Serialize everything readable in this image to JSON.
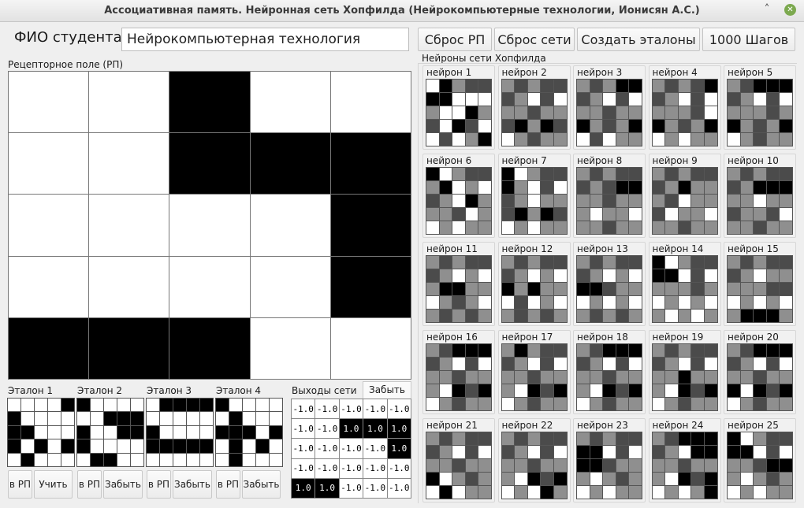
{
  "window": {
    "title": "Ассоциативная память. Нейронная сеть Хопфилда (Нейрокомпьютерные технологии, Ионисян А.С.)",
    "minimize_icon": "minimize-icon",
    "close_icon": "close-icon"
  },
  "student": {
    "label": "ФИО студента",
    "value": "Нейрокомпьютерная технология"
  },
  "toolbar": {
    "reset_field": "Сброс РП",
    "reset_net": "Сброс сети",
    "create_etalons": "Создать эталоны",
    "steps": "1000 Шагов"
  },
  "receptor_field": {
    "label": "Рецепторное поле (РП)",
    "cells": [
      [
        0,
        0,
        1,
        0,
        0
      ],
      [
        0,
        0,
        1,
        1,
        1
      ],
      [
        0,
        0,
        0,
        0,
        1
      ],
      [
        0,
        0,
        0,
        0,
        1
      ],
      [
        1,
        1,
        1,
        0,
        0
      ]
    ]
  },
  "etalons": [
    {
      "label": "Эталон 1",
      "button_to_field": "в РП",
      "button_action": "Учить",
      "cells": [
        [
          0,
          0,
          0,
          0,
          1
        ],
        [
          1,
          0,
          0,
          0,
          0
        ],
        [
          1,
          1,
          0,
          0,
          0
        ],
        [
          1,
          0,
          1,
          0,
          1
        ],
        [
          0,
          1,
          0,
          0,
          0
        ]
      ]
    },
    {
      "label": "Эталон 2",
      "button_to_field": "в РП",
      "button_action": "Забыть",
      "cells": [
        [
          1,
          0,
          0,
          0,
          0
        ],
        [
          0,
          0,
          1,
          1,
          1
        ],
        [
          1,
          0,
          0,
          1,
          1
        ],
        [
          1,
          0,
          0,
          0,
          0
        ],
        [
          0,
          1,
          1,
          0,
          0
        ]
      ]
    },
    {
      "label": "Эталон 3",
      "button_to_field": "в РП",
      "button_action": "Забыть",
      "cells": [
        [
          0,
          1,
          1,
          1,
          1
        ],
        [
          0,
          0,
          0,
          0,
          0
        ],
        [
          1,
          0,
          0,
          0,
          0
        ],
        [
          1,
          1,
          1,
          1,
          1
        ],
        [
          0,
          0,
          0,
          0,
          0
        ]
      ]
    },
    {
      "label": "Эталон 4",
      "button_to_field": "в РП",
      "button_action": "Забыть",
      "cells": [
        [
          1,
          0,
          0,
          0,
          0
        ],
        [
          0,
          1,
          0,
          0,
          0
        ],
        [
          1,
          1,
          1,
          0,
          1
        ],
        [
          0,
          1,
          0,
          1,
          0
        ],
        [
          0,
          1,
          0,
          0,
          0
        ]
      ]
    }
  ],
  "outputs": {
    "label": "Выходы сети",
    "forget_tab": "Забыть",
    "rows": [
      [
        "-1.0",
        "-1.0",
        "-1.0",
        "-1.0",
        "-1.0"
      ],
      [
        "-1.0",
        "-1.0",
        "1.0",
        "1.0",
        "1.0"
      ],
      [
        "-1.0",
        "-1.0",
        "-1.0",
        "-1.0",
        "1.0"
      ],
      [
        "-1.0",
        "-1.0",
        "-1.0",
        "-1.0",
        "-1.0"
      ],
      [
        "1.0",
        "1.0",
        "-1.0",
        "-1.0",
        "-1.0"
      ]
    ]
  },
  "neurons": {
    "label": "Нейроны сети Хопфилда",
    "items": [
      {
        "title": "нейрон 1",
        "cells": [
          "wbgdd",
          "bbwww",
          "gwwbg",
          "dwbdw",
          "wdwgb"
        ]
      },
      {
        "title": "нейрон 2",
        "cells": [
          "gdgdd",
          "dgwdw",
          "ggdgg",
          "dbgbd",
          "wgdgg"
        ]
      },
      {
        "title": "нейрон 3",
        "cells": [
          "gdgbb",
          "dgwdw",
          "ggdgg",
          "bgdgb",
          "wdwgg"
        ]
      },
      {
        "title": "нейрон 4",
        "cells": [
          "gdgdb",
          "dgwdw",
          "gggdw",
          "bgdgb",
          "wgwgg"
        ]
      },
      {
        "title": "нейрон 5",
        "cells": [
          "gdbbb",
          "dgwdw",
          "gggdg",
          "bgdgb",
          "wgdgg"
        ]
      },
      {
        "title": "нейрон 6",
        "cells": [
          "bwgdd",
          "gbwgw",
          "dgwbg",
          "ggdwg",
          "wgwgg"
        ]
      },
      {
        "title": "нейрон 7",
        "cells": [
          "bwgdd",
          "bgwdw",
          "dgwgg",
          "dbgbd",
          "wgwgg"
        ]
      },
      {
        "title": "нейрон 8",
        "cells": [
          "gdgdd",
          "dgdbb",
          "ggdgg",
          "gwggw",
          "ggdgg"
        ]
      },
      {
        "title": "нейрон 9",
        "cells": [
          "gdgdd",
          "dgbgg",
          "gdwgg",
          "dwggw",
          "ggdgg"
        ]
      },
      {
        "title": "нейрон 10",
        "cells": [
          "gdgdd",
          "dgbbb",
          "ggwgg",
          "dggdw",
          "ggdgg"
        ]
      },
      {
        "title": "нейрон 11",
        "cells": [
          "gdgdd",
          "dgwgw",
          "gbbgg",
          "wgdgw",
          "gdgdg"
        ]
      },
      {
        "title": "нейрон 12",
        "cells": [
          "gdgdd",
          "dgwgw",
          "bgbgg",
          "wdwgw",
          "gdgdg"
        ]
      },
      {
        "title": "нейрон 13",
        "cells": [
          "gdgdd",
          "dgwgw",
          "bbdgg",
          "wgwgw",
          "gdgdg"
        ]
      },
      {
        "title": "нейрон 14",
        "cells": [
          "bwgdd",
          "bbwdw",
          "gggdg",
          "wgwgw",
          "gwgwg"
        ]
      },
      {
        "title": "нейрон 15",
        "cells": [
          "gdgdd",
          "dgwgg",
          "gggdd",
          "wgwgw",
          "gbbbg"
        ]
      },
      {
        "title": "нейрон 16",
        "cells": [
          "gdbbb",
          "dgwdw",
          "ggdgg",
          "gwbdb",
          "wgdgg"
        ]
      },
      {
        "title": "нейрон 17",
        "cells": [
          "gbgdd",
          "dgwdw",
          "ggdgg",
          "gwbdb",
          "wgdgg"
        ]
      },
      {
        "title": "нейрон 18",
        "cells": [
          "gdbbb",
          "dgwdw",
          "ggdgg",
          "gwbdb",
          "wgdgg"
        ]
      },
      {
        "title": "нейрон 19",
        "cells": [
          "gdgdd",
          "dgwdw",
          "ggbgg",
          "gwbdb",
          "wgdgg"
        ]
      },
      {
        "title": "нейрон 20",
        "cells": [
          "gdbbb",
          "dgwdw",
          "ggdgg",
          "bwbdb",
          "wgdgg"
        ]
      },
      {
        "title": "нейрон 21",
        "cells": [
          "gdgdd",
          "dgwdw",
          "ggdgg",
          "bwgdg",
          "wbwgg"
        ]
      },
      {
        "title": "нейрон 22",
        "cells": [
          "gdgdd",
          "dgwdw",
          "ggdgg",
          "gwbdb",
          "wgwbg"
        ]
      },
      {
        "title": "нейрон 23",
        "cells": [
          "gdgdd",
          "bbwdw",
          "bbdgg",
          "gwgdg",
          "wgwgg"
        ]
      },
      {
        "title": "нейрон 24",
        "cells": [
          "gdbbb",
          "dgwbb",
          "ggdgg",
          "gwbdb",
          "wgwgb"
        ]
      },
      {
        "title": "нейрон 25",
        "cells": [
          "bwgdd",
          "bbwdw",
          "ggdbb",
          "gwgdg",
          "wgwgg"
        ]
      }
    ]
  }
}
